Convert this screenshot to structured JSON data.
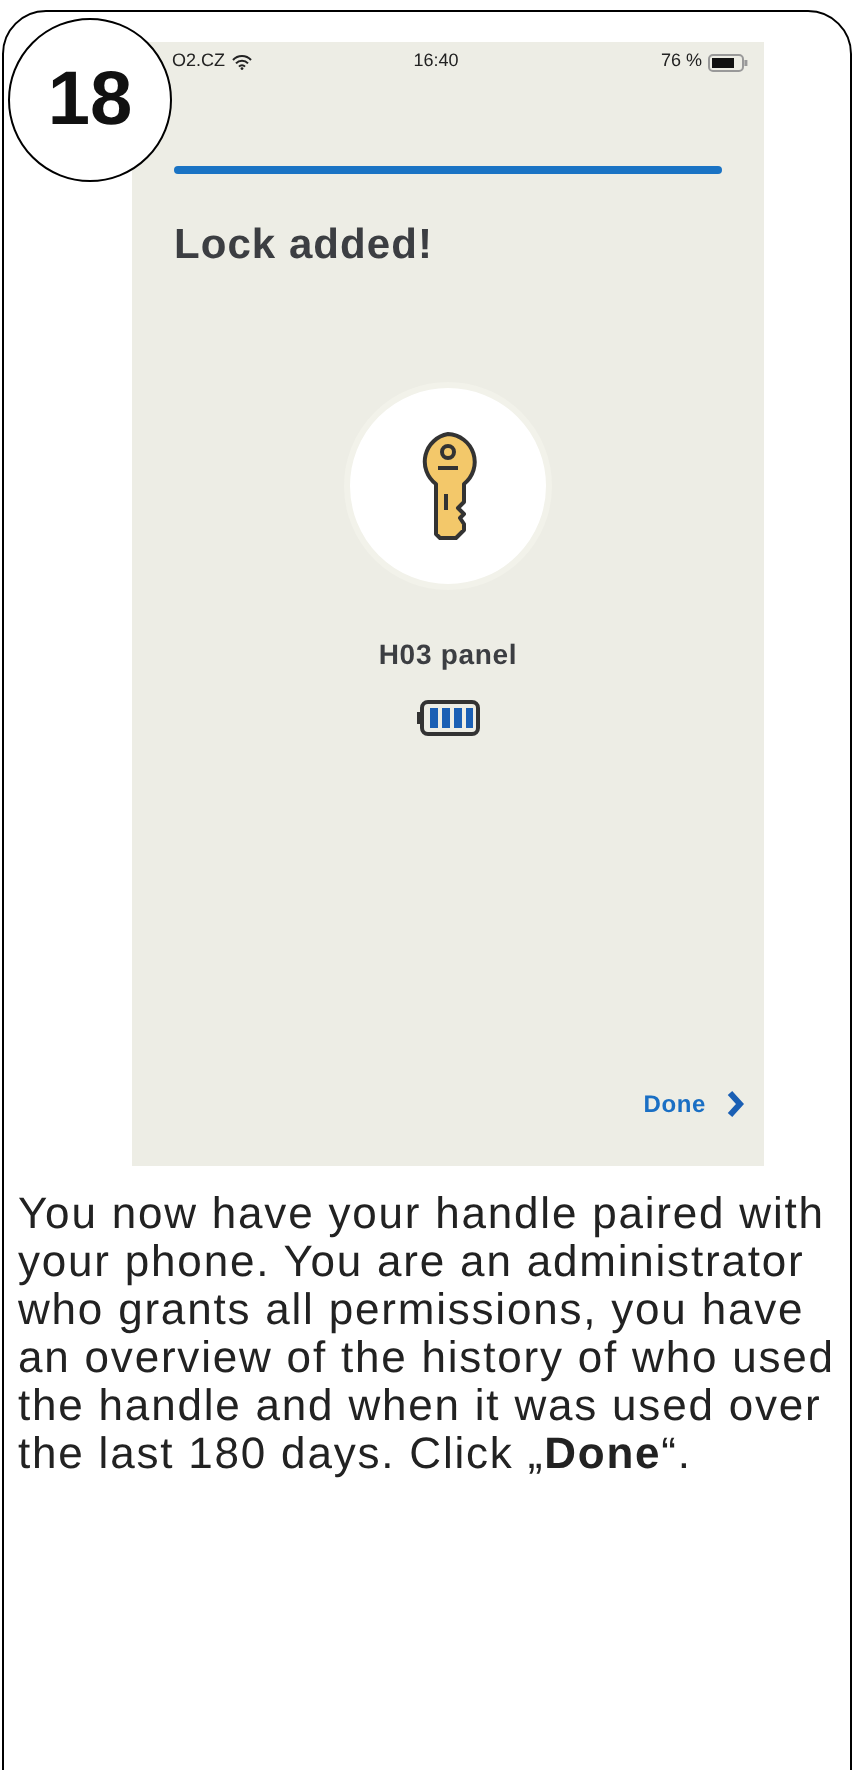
{
  "step": "18",
  "status_bar": {
    "carrier": "O2.CZ",
    "time": "16:40",
    "battery": "76 %"
  },
  "title": "Lock added!",
  "lock": {
    "name": "H03 panel"
  },
  "done_button": {
    "label": "Done"
  },
  "instructions": "You now have your handle paired with your phone. You are an administrator who grants all permissions, you have an overview of the history of who used the handle and when it was used over the last 180 days. Click „**Done**“."
}
